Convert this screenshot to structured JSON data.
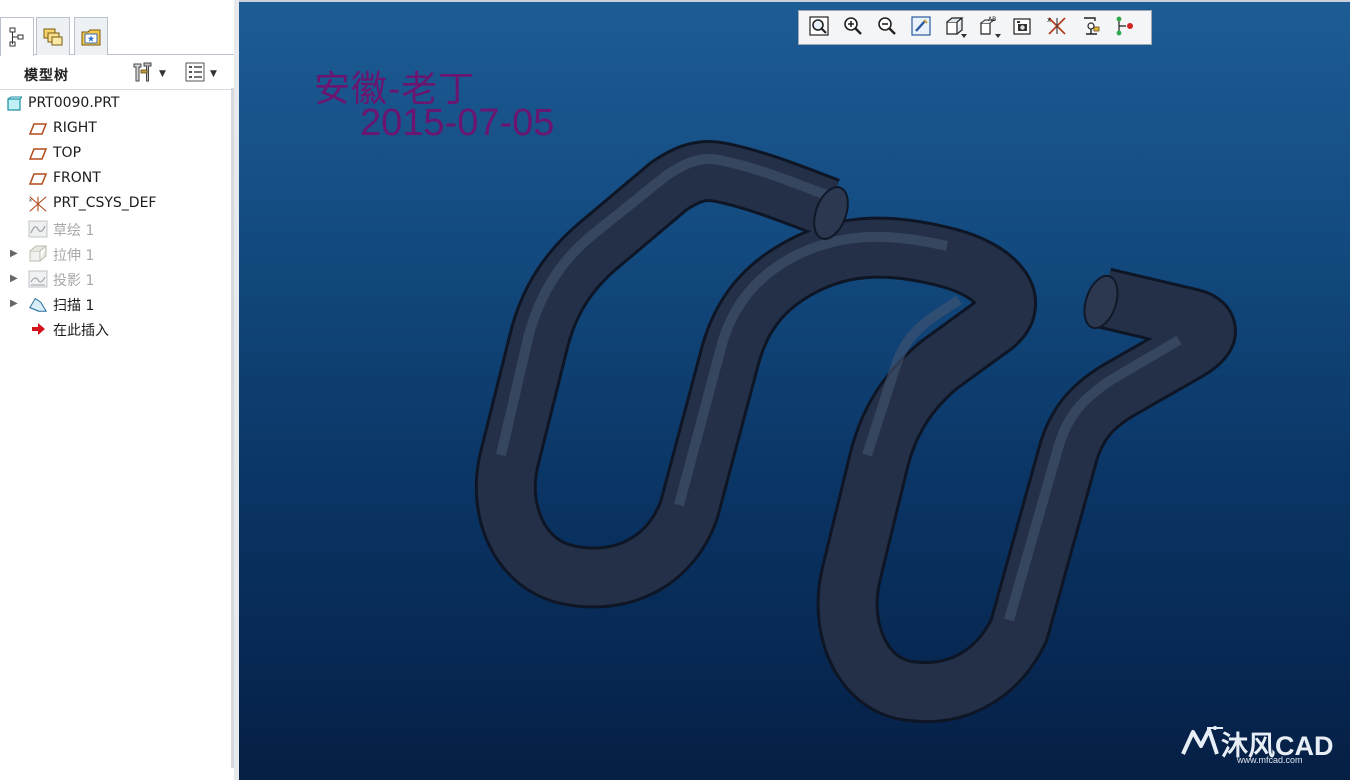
{
  "left_panel": {
    "tabs": [
      {
        "icon": "model-tree-icon",
        "active": true
      },
      {
        "icon": "layers-icon",
        "active": false
      },
      {
        "icon": "favorites-folder-icon",
        "active": false
      }
    ],
    "tree_title": "模型树",
    "settings_icon": "tree-settings-icon",
    "columns_icon": "tree-columns-icon",
    "items": [
      {
        "label": "PRT0090.PRT",
        "icon": "part-icon",
        "state": "normal",
        "expandable": false
      },
      {
        "label": "RIGHT",
        "icon": "datum-plane-icon",
        "state": "normal",
        "expandable": false
      },
      {
        "label": "TOP",
        "icon": "datum-plane-icon",
        "state": "normal",
        "expandable": false
      },
      {
        "label": "FRONT",
        "icon": "datum-plane-icon",
        "state": "normal",
        "expandable": false
      },
      {
        "label": "PRT_CSYS_DEF",
        "icon": "coordinate-system-icon",
        "state": "normal",
        "expandable": false
      },
      {
        "label": "草绘 1",
        "icon": "sketch-icon",
        "state": "suppressed",
        "expandable": false
      },
      {
        "label": "拉伸 1",
        "icon": "extrude-icon",
        "state": "suppressed",
        "expandable": true
      },
      {
        "label": "投影 1",
        "icon": "projection-icon",
        "state": "suppressed",
        "expandable": true
      },
      {
        "label": "扫描 1",
        "icon": "sweep-icon",
        "state": "normal",
        "expandable": true
      },
      {
        "label": "在此插入",
        "icon": "insert-here-arrow-icon",
        "state": "normal",
        "expandable": false
      }
    ]
  },
  "viewport": {
    "toolbar": [
      {
        "icon": "refit-icon"
      },
      {
        "icon": "zoom-in-icon"
      },
      {
        "icon": "zoom-out-icon"
      },
      {
        "icon": "repaint-icon"
      },
      {
        "icon": "display-style-icon"
      },
      {
        "icon": "saved-orientations-icon"
      },
      {
        "icon": "view-manager-icon"
      },
      {
        "icon": "datum-display-icon"
      },
      {
        "icon": "annotation-display-icon"
      },
      {
        "icon": "spin-center-icon"
      }
    ],
    "annotation_name": "安徽-老丁",
    "annotation_date": "2015-07-05",
    "watermark_text": "沐风CAD",
    "watermark_url": "www.mfcad.com"
  },
  "colors": {
    "viewport_top": "#1d5c95",
    "viewport_bottom": "#051f45",
    "model_tube": "#232f44",
    "annotation": "#6b1470"
  }
}
